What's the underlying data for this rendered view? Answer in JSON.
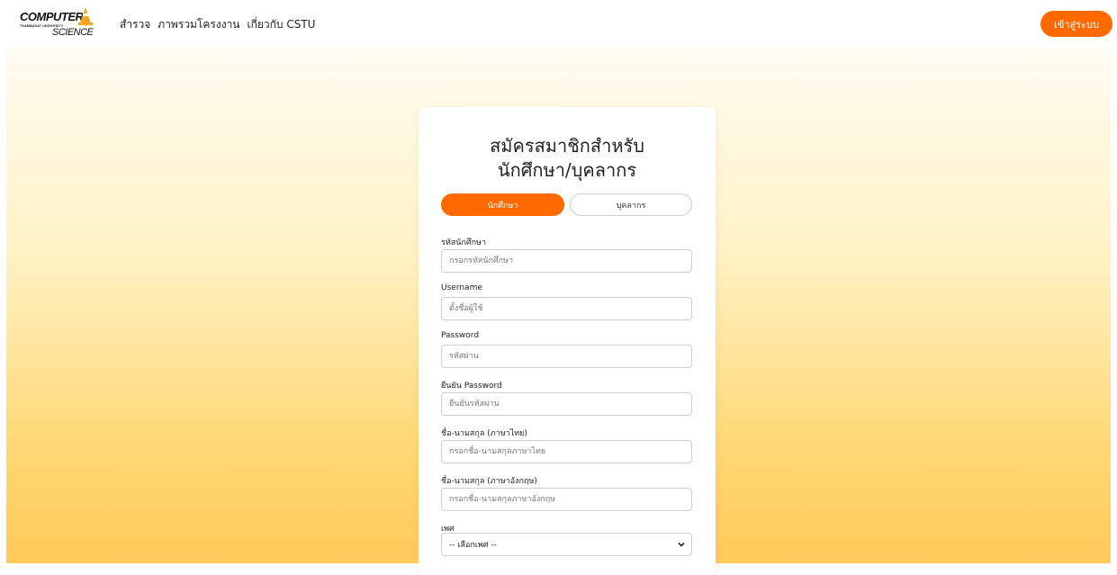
{
  "brand": {
    "logo_top": "COMPUTER",
    "logo_sub": "THAMMASAT UNIVERSITY",
    "logo_bottom": "SCIENCE",
    "accent": "#ff6a00"
  },
  "nav": {
    "links": [
      {
        "label": "สำรวจ"
      },
      {
        "label": "ภาพรวมโครงงาน"
      },
      {
        "label": "เกี่ยวกับ CSTU"
      }
    ],
    "login_label": "เข้าสู่ระบบ"
  },
  "form": {
    "title_line1": "สมัครสมาชิกสำหรับ",
    "title_line2": "นักศึกษา/บุคลากร",
    "tabs": [
      {
        "label": "นักศึกษา",
        "active": true
      },
      {
        "label": "บุคลากร",
        "active": false
      }
    ],
    "fields": [
      {
        "label": "รหัสนักศึกษา",
        "placeholder": "กรอกรหัสนักศึกษา"
      },
      {
        "label": "Username",
        "placeholder": "ตั้งชื่อผู้ใช้"
      },
      {
        "label": "Password",
        "placeholder": "รหัสผ่าน"
      },
      {
        "label": "ยืนยัน Password",
        "placeholder": "ยืนยันรหัสผ่าน"
      },
      {
        "label": "ชื่อ-นามสกุล (ภาษาไทย)",
        "placeholder": "กรอกชื่อ-นามสกุลภาษาไทย"
      },
      {
        "label": "ชื่อ-นามสกุล (ภาษาอังกฤษ)",
        "placeholder": "กรอกชื่อ-นามสกุลภาษาอังกฤษ"
      }
    ],
    "gender": {
      "label": "เพศ",
      "selected": "-- เลือกเพศ --"
    }
  }
}
